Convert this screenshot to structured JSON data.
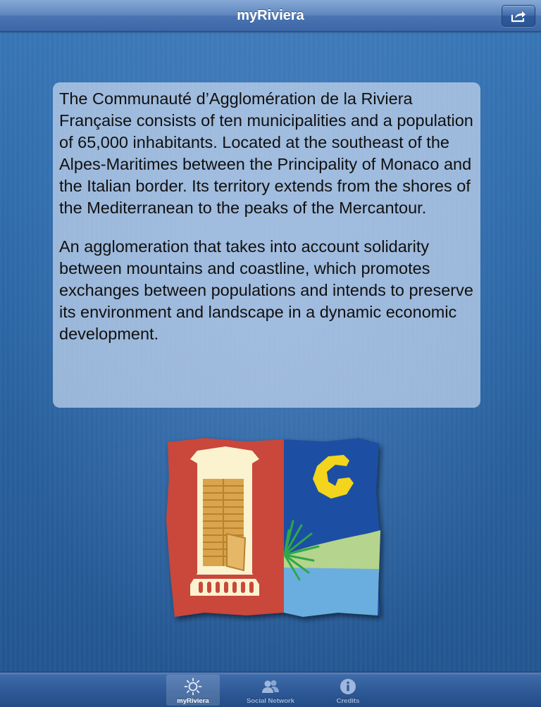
{
  "navbar": {
    "title": "myRiviera",
    "share_icon": "share-icon"
  },
  "content": {
    "paragraphs": [
      "The Communauté d’Agglomération de la Riviera Française consists of ten municipalities and a population of 65,000 inhabitants. Located at the southeast of the Alpes-Maritimes between the Principality of Monaco and the Italian border. Its territory extends from the shores of the Mediterranean to the peaks of the Mercantour.",
      "An agglomeration that takes into account solidarity between mountains and coastline, which promotes exchanges between populations and intends to preserve its environment and landscape in a dynamic economic development."
    ]
  },
  "tabbar": {
    "tabs": [
      {
        "label": "myRiviera",
        "icon": "sun-icon",
        "selected": true
      },
      {
        "label": "Social Network",
        "icon": "people-icon",
        "selected": false
      },
      {
        "label": "Credits",
        "icon": "info-icon",
        "selected": false
      }
    ]
  },
  "colors": {
    "background": "#2b68a8",
    "navbar": "#4b74b2",
    "logo_red": "#c9473a",
    "logo_blue": "#1a4fa3",
    "logo_yellow": "#f2d51c"
  }
}
